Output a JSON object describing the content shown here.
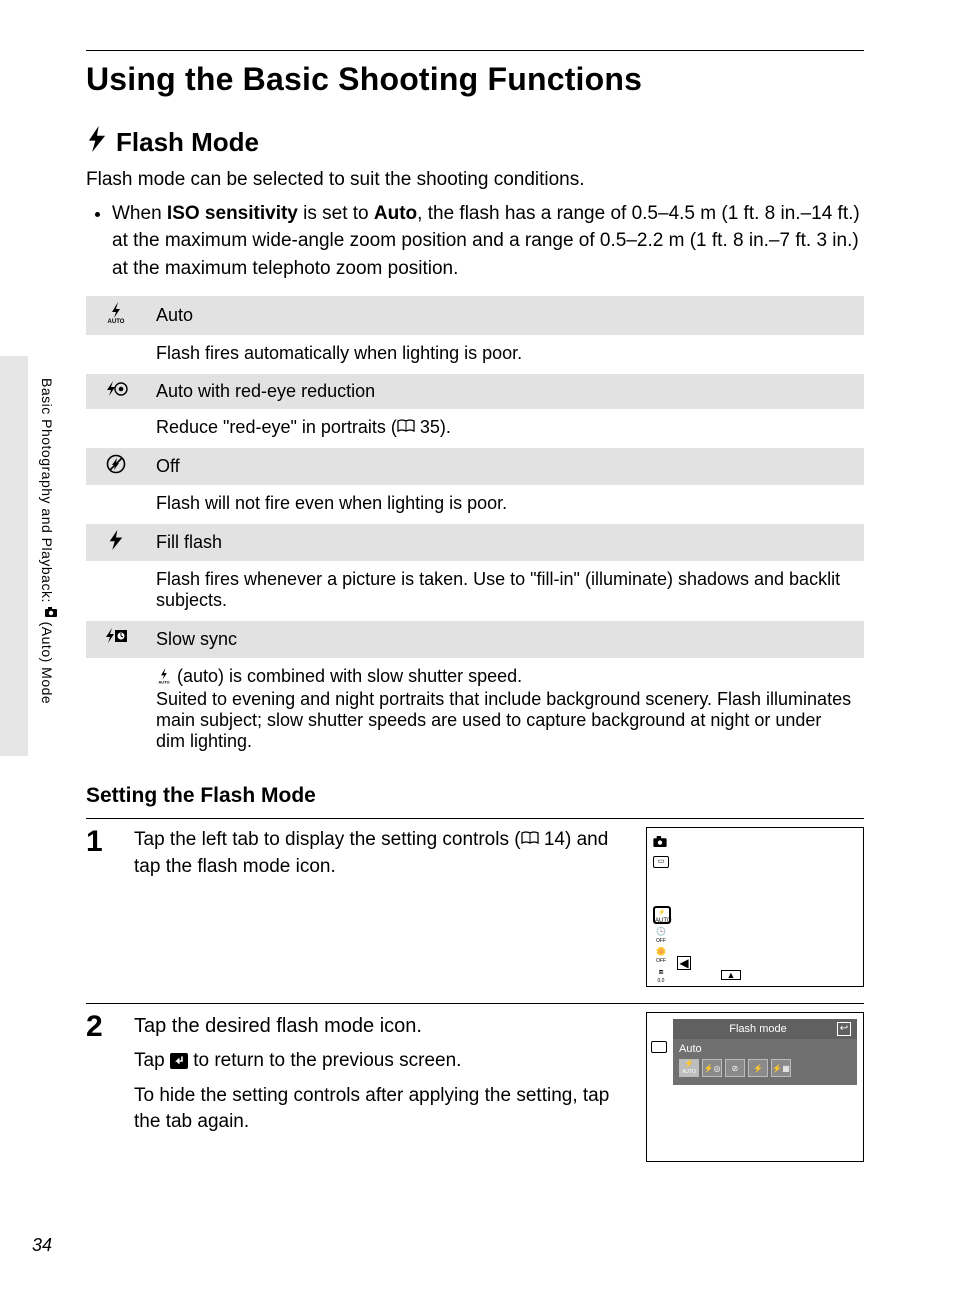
{
  "page_number": "34",
  "sidebar_text": "Basic Photography and Playback: 📷 (Auto) Mode",
  "h1": "Using the Basic Shooting Functions",
  "flash_icon": "⚡",
  "h2": "Flash Mode",
  "intro": "Flash mode can be selected to suit the shooting conditions.",
  "bullet_prefix": "When ",
  "bullet_b1": "ISO sensitivity",
  "bullet_mid": " is set to ",
  "bullet_b2": "Auto",
  "bullet_rest": ", the flash has a range of 0.5–4.5 m (1 ft. 8 in.–14 ft.) at the maximum wide-angle zoom position and a range of 0.5–2.2 m (1 ft. 8 in.–7 ft. 3 in.) at the maximum telephoto zoom position.",
  "modes": [
    {
      "icon": "auto",
      "label": "Auto",
      "desc": "Flash fires automatically when lighting is poor."
    },
    {
      "icon": "redeye",
      "label": "Auto with red-eye reduction",
      "desc": "Reduce \"red-eye\" in portraits (📖 35)."
    },
    {
      "icon": "off",
      "label": "Off",
      "desc": "Flash will not fire even when lighting is poor."
    },
    {
      "icon": "fill",
      "label": "Fill flash",
      "desc": "Flash fires whenever a picture is taken. Use to \"fill-in\" (illuminate) shadows and backlit subjects."
    },
    {
      "icon": "slow",
      "label": "Slow sync",
      "desc": "⚡AUTO (auto) is combined with slow shutter speed.\nSuited to evening and night portraits that include background scenery. Flash illuminates main subject; slow shutter speeds are used to capture background at night or under dim lighting."
    }
  ],
  "setting_head": "Setting the Flash Mode",
  "step1_num": "1",
  "step1_text_a": "Tap the left tab to display the setting controls (",
  "step1_ref": "14",
  "step1_text_b": ") and tap the flash mode icon.",
  "step2_num": "2",
  "step2_head": "Tap the desired flash mode icon.",
  "step2_p1a": "Tap ",
  "step2_p1b": " to return to the previous screen.",
  "step2_p2": "To hide the setting controls after applying the setting, tap the tab again.",
  "thumb2_title": "Flash mode",
  "thumb2_selected": "Auto",
  "thumb2_icons": [
    "AUTO",
    "⚡◎",
    "⊘",
    "⚡",
    "⚡★"
  ]
}
